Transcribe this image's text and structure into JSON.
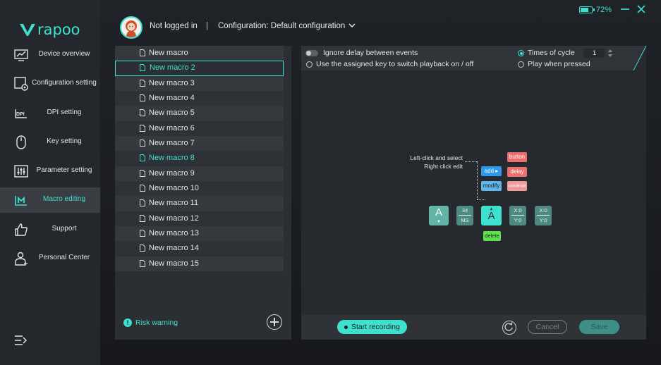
{
  "brand": {
    "logo_text": "rapoo",
    "accent": "#3ee0d0"
  },
  "sidebar": {
    "items": [
      {
        "label": "Device overview",
        "icon": "monitor-chart-icon"
      },
      {
        "label": "Configuration setting",
        "icon": "config-gear-icon"
      },
      {
        "label": "DPI setting",
        "icon": "dpi-icon"
      },
      {
        "label": "Key setting",
        "icon": "mouse-icon"
      },
      {
        "label": "Parameter setting",
        "icon": "sliders-icon"
      },
      {
        "label": "Macro editing",
        "icon": "macro-icon",
        "active": true
      },
      {
        "label": "Support",
        "icon": "thumbs-up-icon"
      },
      {
        "label": "Personal Center",
        "icon": "person-icon"
      }
    ],
    "menu_icon": "menu-icon"
  },
  "header": {
    "login_status": "Not logged in",
    "separator": "|",
    "configuration": "Configuration: Default configuration",
    "battery_level": 0.72,
    "battery_text": "72%"
  },
  "macros": {
    "items": [
      "New macro",
      "New macro 2",
      "New macro 3",
      "New macro 4",
      "New macro 5",
      "New macro 6",
      "New macro 7",
      "New macro 8",
      "New macro 9",
      "New macro 10",
      "New macro 11",
      "New macro 12",
      "New macro 13",
      "New macro 14",
      "New macro 15"
    ],
    "selected_index": 1,
    "highlighted_index": 7,
    "risk_warning": "Risk warning"
  },
  "editor": {
    "ignore_delay": "Ignore delay between events",
    "assigned_key": "Use the assigned key to switch playback on / off",
    "times_of_cycle": "Times of cycle",
    "cycle_value": "1",
    "play_when_pressed": "Play when pressed",
    "hint_line1": "Left-click and select",
    "hint_line2": "Right click edit",
    "add_label": "add",
    "modify_label": "modify",
    "button_label": "button",
    "delay_label": "delay",
    "coordinate_label": "coordinate",
    "key_a1": "A",
    "delay_value": "34",
    "delay_unit": "MS",
    "key_a2": "A",
    "coord1_x": "X:0",
    "coord1_y": "Y:0",
    "coord2_x": "X:0",
    "coord2_y": "Y:0",
    "delete_label": "delete"
  },
  "bottom": {
    "start_recording": "Start recording",
    "cancel": "Cancel",
    "save": "Save"
  }
}
